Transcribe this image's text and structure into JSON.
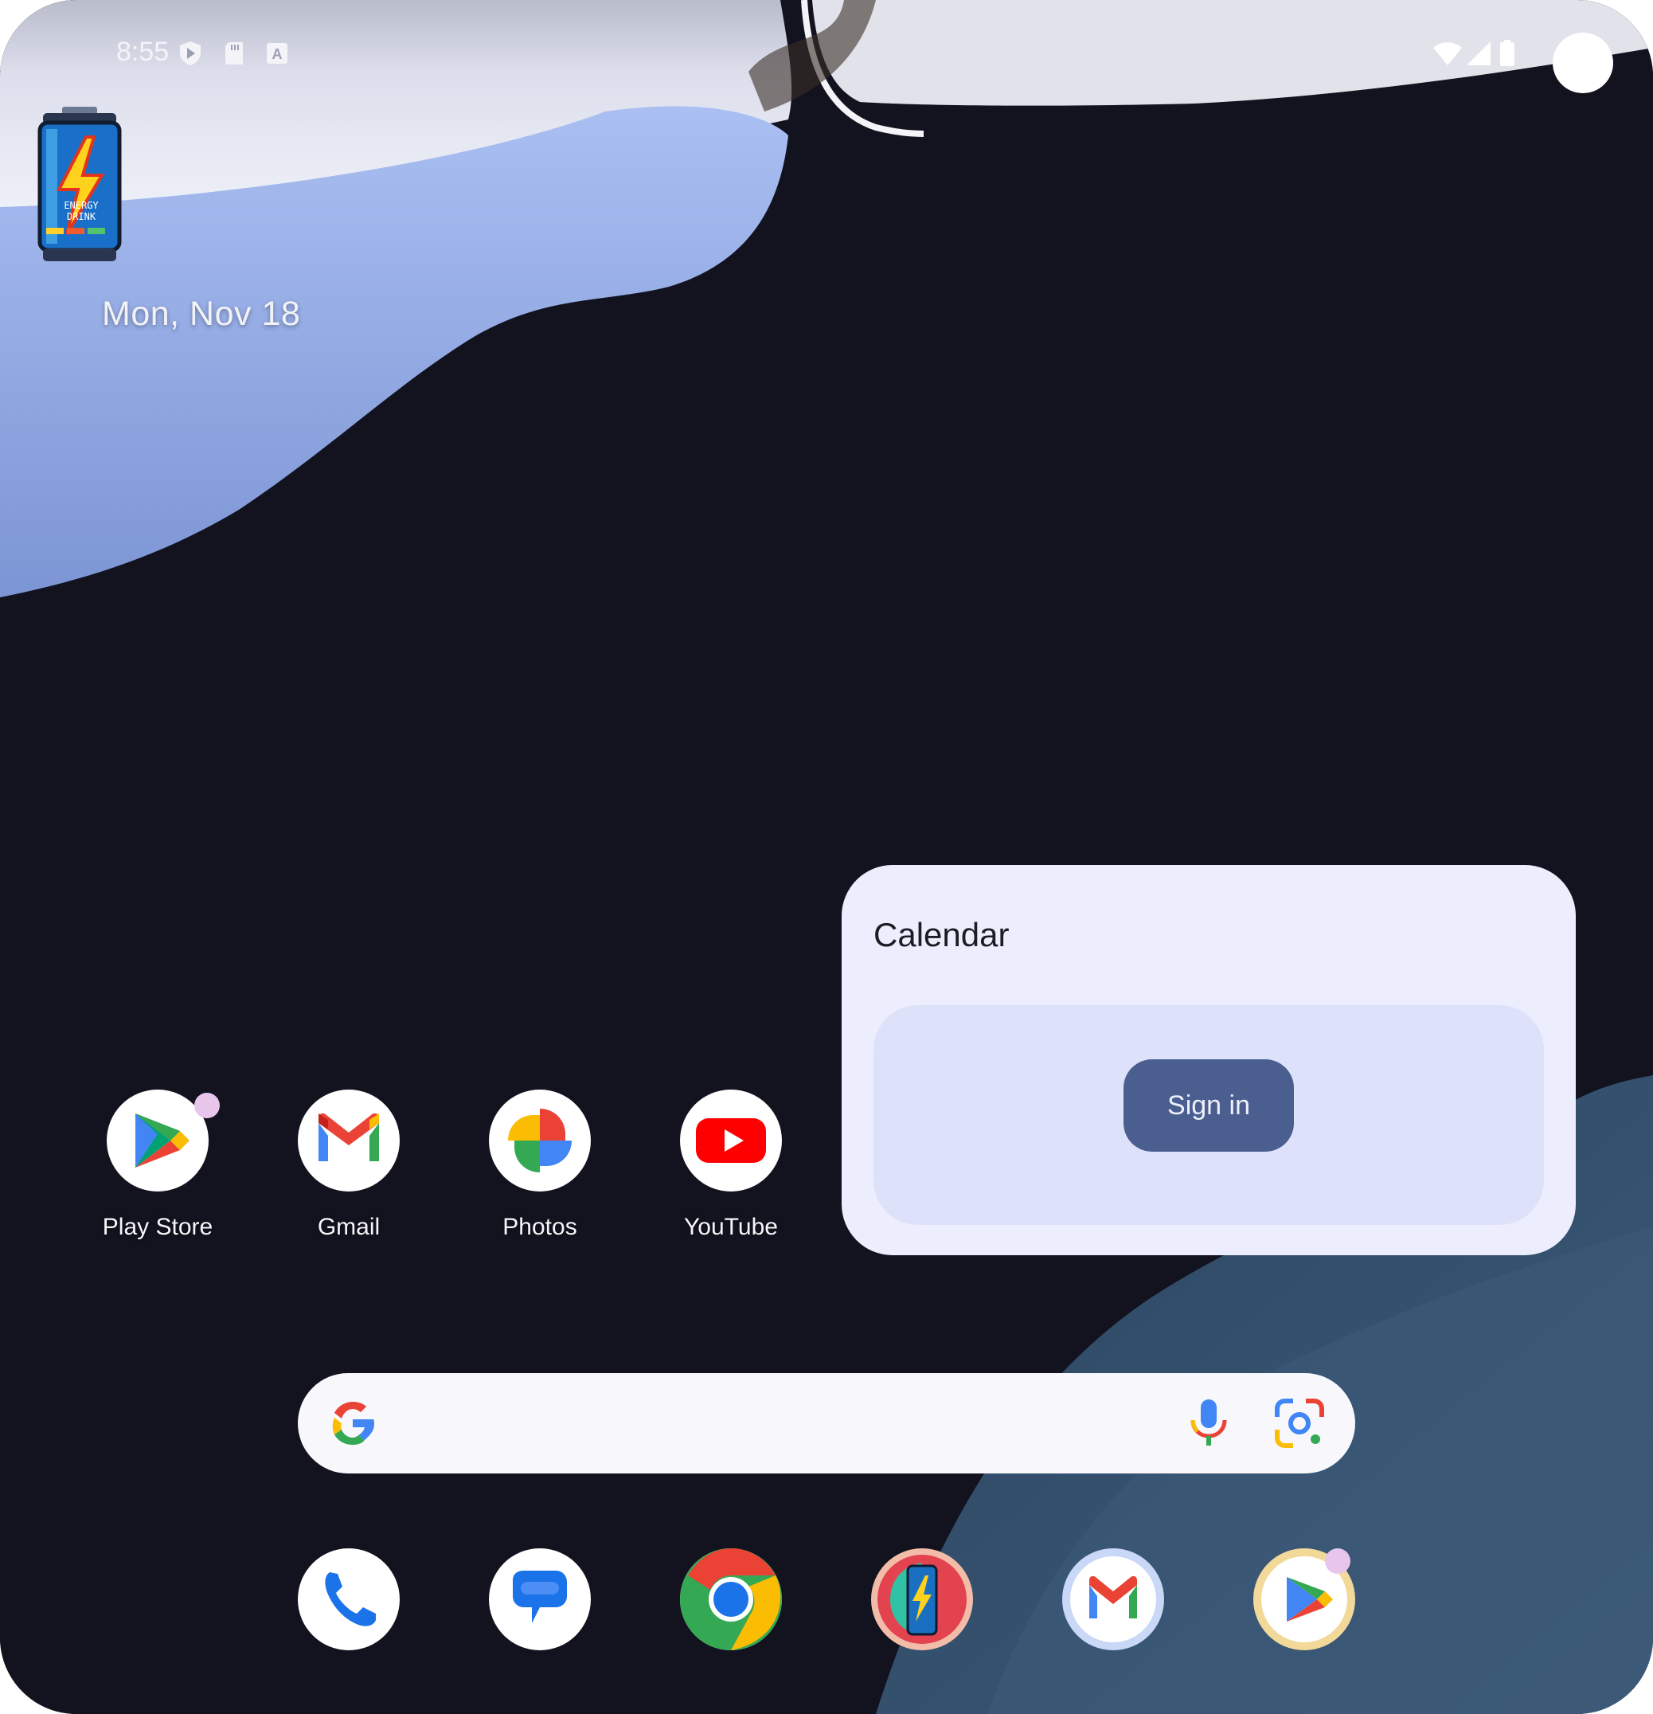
{
  "status_bar": {
    "time": "8:55",
    "left_icons": [
      "shield-play-icon",
      "sd-card-icon",
      "keyboard-a-icon"
    ],
    "right_icons": [
      "wifi-icon",
      "cell-signal-icon",
      "battery-icon"
    ]
  },
  "home": {
    "shortcut_icon": "energy-drink-can-icon",
    "date": "Mon, Nov 18"
  },
  "apps": [
    {
      "label": "Play Store",
      "icon": "play-store-icon",
      "notification_dot": true
    },
    {
      "label": "Gmail",
      "icon": "gmail-icon",
      "notification_dot": false
    },
    {
      "label": "Photos",
      "icon": "photos-icon",
      "notification_dot": false
    },
    {
      "label": "YouTube",
      "icon": "youtube-icon",
      "notification_dot": false
    }
  ],
  "calendar_widget": {
    "title": "Calendar",
    "button_label": "Sign in"
  },
  "search_bar": {
    "icons": [
      "google-g-icon",
      "microphone-icon",
      "google-lens-icon"
    ]
  },
  "dock": [
    {
      "icon": "phone-icon"
    },
    {
      "icon": "messages-icon"
    },
    {
      "icon": "chrome-icon"
    },
    {
      "icon": "energy-drink-app-icon"
    },
    {
      "icon": "gmail-icon"
    },
    {
      "icon": "play-store-icon",
      "notification_dot": true
    }
  ],
  "colors": {
    "wallpaper_dark": "#12131f",
    "wallpaper_light": "#d8dcf0",
    "wallpaper_blue": "#a8bdf0",
    "widget_bg": "#eceefd",
    "widget_inner": "#dde1f9",
    "button": "#4a5e90"
  }
}
